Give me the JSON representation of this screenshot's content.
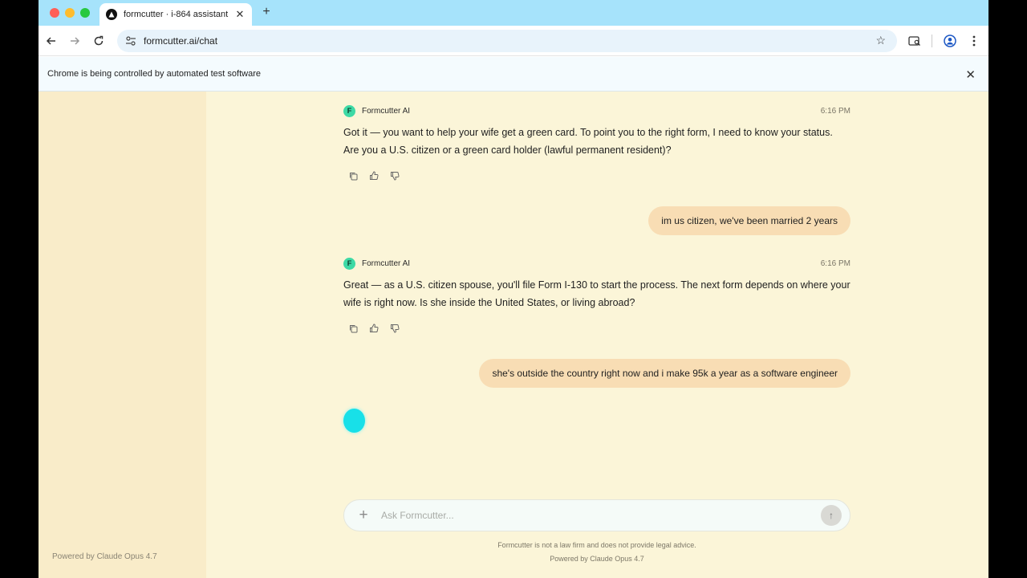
{
  "browser": {
    "tab_title": "formcutter · i-864 assistant",
    "tab_close": "✕",
    "new_tab": "+",
    "url": "formcutter.ai/chat",
    "infobar_text": "Chrome is being controlled by automated test software",
    "infobar_close": "✕"
  },
  "sidebar": {
    "footer": "Powered by Claude Opus 4.7"
  },
  "messages": [
    {
      "role": "assistant",
      "sender": "Formcutter AI",
      "avatar_letter": "F",
      "time": "6:16 PM",
      "text": "Got it — you want to help your wife get a green card. To point you to the right form, I need to know your status. Are you a U.S. citizen or a green card holder (lawful permanent resident)?"
    },
    {
      "role": "user",
      "text": "im us citizen, we've been married 2 years"
    },
    {
      "role": "assistant",
      "sender": "Formcutter AI",
      "avatar_letter": "F",
      "time": "6:16 PM",
      "text": "Great — as a U.S. citizen spouse, you'll file Form I-130 to start the process. The next form depends on where your wife is right now. Is she inside the United States, or living abroad?"
    },
    {
      "role": "user",
      "text": "she's outside the country right now and i make 95k a year as a software engineer"
    }
  ],
  "composer": {
    "plus": "+",
    "placeholder": "Ask Formcutter...",
    "send": "↑"
  },
  "footer": {
    "disclaimer": "Formcutter is not a law firm and does not provide legal advice.",
    "powered_by": "Powered by Claude Opus 4.7"
  },
  "colors": {
    "page_bg": "#fbf5d8",
    "sidebar_bg": "#f9ecc9",
    "user_bubble": "#f8ddb4",
    "ai_avatar": "#3dd9a5",
    "typing_indicator": "#18e0e8"
  }
}
